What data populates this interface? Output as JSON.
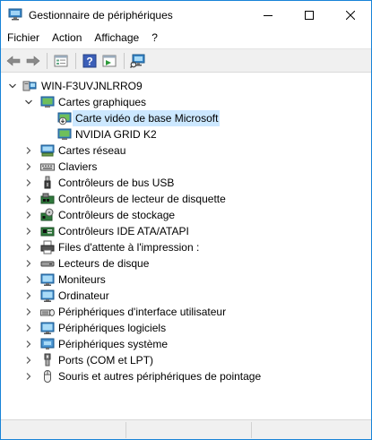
{
  "window": {
    "title": "Gestionnaire de périphériques",
    "icon": "device-manager-icon"
  },
  "menubar": {
    "items": [
      "Fichier",
      "Action",
      "Affichage",
      "?"
    ]
  },
  "toolbar": {
    "buttons": [
      "back-arrow-icon",
      "forward-arrow-icon",
      "properties-icon",
      "help-icon",
      "update-driver-icon",
      "scan-hardware-icon"
    ]
  },
  "tree": {
    "root": {
      "label": "WIN-F3UVJNLRRO9",
      "icon": "computer-icon",
      "expanded": true
    },
    "categories": [
      {
        "label": "Cartes graphiques",
        "icon": "display-adapter-icon",
        "expanded": true,
        "children": [
          {
            "label": "Carte vidéo de base Microsoft",
            "icon": "display-adapter-warning-icon",
            "selected": true
          },
          {
            "label": "NVIDIA GRID K2",
            "icon": "display-adapter-icon",
            "selected": false
          }
        ]
      },
      {
        "label": "Cartes réseau",
        "icon": "network-adapter-icon",
        "expanded": false
      },
      {
        "label": "Claviers",
        "icon": "keyboard-icon",
        "expanded": false
      },
      {
        "label": "Contrôleurs de bus USB",
        "icon": "usb-icon",
        "expanded": false
      },
      {
        "label": "Contrôleurs de lecteur de disquette",
        "icon": "floppy-controller-icon",
        "expanded": false
      },
      {
        "label": "Contrôleurs de stockage",
        "icon": "storage-controller-icon",
        "expanded": false
      },
      {
        "label": "Contrôleurs IDE ATA/ATAPI",
        "icon": "ide-controller-icon",
        "expanded": false
      },
      {
        "label": "Files d'attente à l'impression :",
        "icon": "print-queue-icon",
        "expanded": false
      },
      {
        "label": "Lecteurs de disque",
        "icon": "disk-drive-icon",
        "expanded": false
      },
      {
        "label": "Moniteurs",
        "icon": "monitor-icon",
        "expanded": false
      },
      {
        "label": "Ordinateur",
        "icon": "computer-icon",
        "expanded": false
      },
      {
        "label": "Périphériques d'interface utilisateur",
        "icon": "hid-icon",
        "expanded": false
      },
      {
        "label": "Périphériques logiciels",
        "icon": "software-device-icon",
        "expanded": false
      },
      {
        "label": "Périphériques système",
        "icon": "system-device-icon",
        "expanded": false
      },
      {
        "label": "Ports (COM et LPT)",
        "icon": "port-icon",
        "expanded": false
      },
      {
        "label": "Souris et autres périphériques de pointage",
        "icon": "mouse-icon",
        "expanded": false
      }
    ]
  },
  "colors": {
    "window_border": "#1883d7",
    "selection": "#cce8ff",
    "toolbar_bg": "#f0f0f0"
  }
}
